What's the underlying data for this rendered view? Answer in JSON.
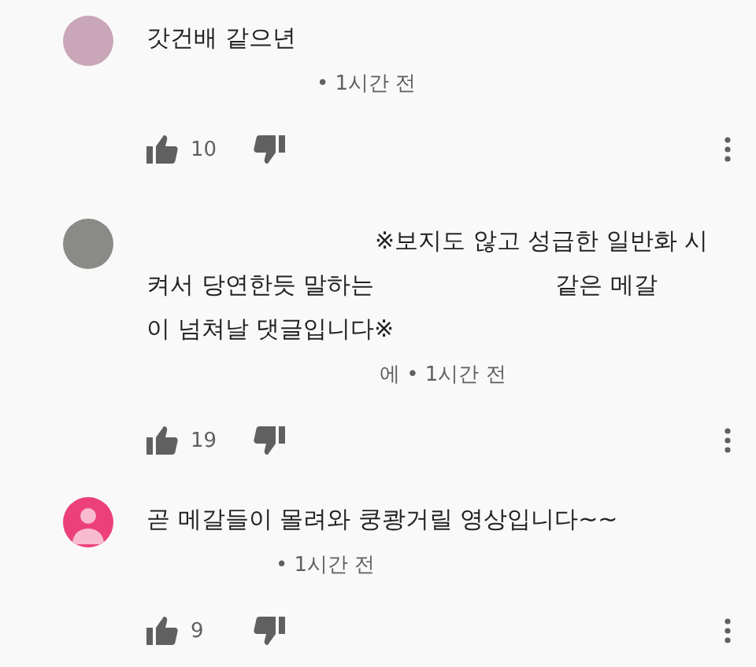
{
  "comments": [
    {
      "avatar": {
        "kind": "image"
      },
      "body": [
        [
          "갓건배 같으년"
        ]
      ],
      "meta": "• 1시간 전",
      "likes": "10"
    },
    {
      "avatar": {
        "kind": "photo"
      },
      "body": [
        [
          "※보지도 않고 성급한 일반화 시"
        ],
        [
          "켜서 당연한듯 말하는",
          "같은 메갈"
        ],
        [
          "이 넘쳐날 댓글입니다※"
        ]
      ],
      "meta": "에 • 1시간 전",
      "likes": "19"
    },
    {
      "avatar": {
        "kind": "default"
      },
      "body": [
        [
          "곧 메갈들이 몰려와 쿵쾅거릴 영상입니다~~"
        ]
      ],
      "meta": "• 1시간 전",
      "likes": "9"
    }
  ]
}
